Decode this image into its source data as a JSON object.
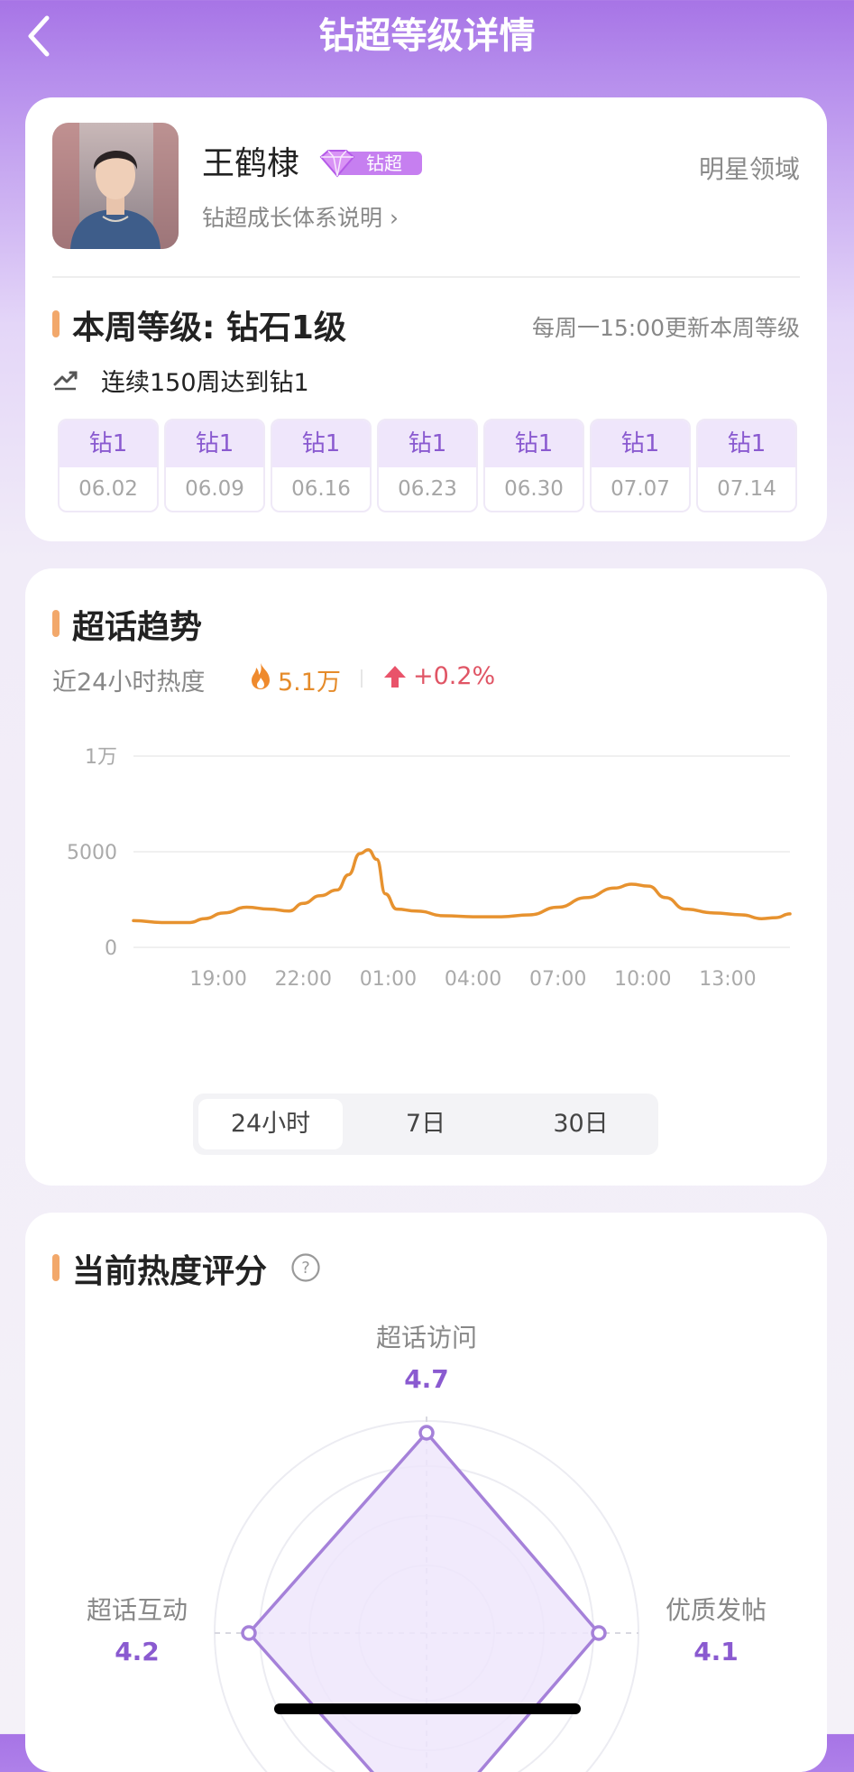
{
  "header": {
    "title": "钻超等级详情"
  },
  "profile": {
    "name": "王鹤棣",
    "badge": "钻超",
    "growth_link": "钻超成长体系说明 ›",
    "domain": "明星领域"
  },
  "level": {
    "title": "本周等级: 钻石1级",
    "update_note": "每周一15:00更新本周等级",
    "streak": "连续150周达到钻1",
    "weeks": [
      {
        "level": "钻1",
        "date": "06.02"
      },
      {
        "level": "钻1",
        "date": "06.09"
      },
      {
        "level": "钻1",
        "date": "06.16"
      },
      {
        "level": "钻1",
        "date": "06.23"
      },
      {
        "level": "钻1",
        "date": "06.30"
      },
      {
        "level": "钻1",
        "date": "07.07"
      },
      {
        "level": "钻1",
        "date": "07.14"
      }
    ]
  },
  "trend": {
    "title": "超话趋势",
    "heat_label": "近24小时热度",
    "heat_value": "5.1万",
    "heat_change": "+0.2%",
    "tabs": [
      "24小时",
      "7日",
      "30日"
    ],
    "active_tab": "24小时"
  },
  "chart_data": {
    "type": "line",
    "title": "",
    "xlabel": "",
    "ylabel": "",
    "y_tick_labels": [
      "0",
      "5000",
      "1万"
    ],
    "y_ticks": [
      0,
      5000,
      10000
    ],
    "ylim": [
      0,
      10000
    ],
    "x_tick_labels": [
      "19:00",
      "22:00",
      "01:00",
      "04:00",
      "07:00",
      "10:00",
      "13:00"
    ],
    "x_tick_positions": [
      19,
      22,
      25,
      28,
      31,
      34,
      37
    ],
    "xlim": [
      16,
      39.2
    ],
    "grid": true,
    "color": "#e7922f",
    "series": [
      {
        "name": "",
        "points": [
          [
            16,
            1400
          ],
          [
            17,
            1300
          ],
          [
            18,
            1300
          ],
          [
            18.5,
            1500
          ],
          [
            19.2,
            1800
          ],
          [
            20,
            2100
          ],
          [
            20.8,
            2000
          ],
          [
            21.5,
            1900
          ],
          [
            22,
            2300
          ],
          [
            22.6,
            2700
          ],
          [
            23.2,
            3000
          ],
          [
            23.6,
            3800
          ],
          [
            24,
            4900
          ],
          [
            24.3,
            5100
          ],
          [
            24.6,
            4600
          ],
          [
            24.9,
            2800
          ],
          [
            25.3,
            2000
          ],
          [
            26,
            1900
          ],
          [
            27,
            1650
          ],
          [
            28,
            1600
          ],
          [
            29,
            1600
          ],
          [
            30,
            1700
          ],
          [
            31,
            2100
          ],
          [
            32,
            2600
          ],
          [
            33,
            3100
          ],
          [
            33.6,
            3300
          ],
          [
            34.2,
            3200
          ],
          [
            34.8,
            2600
          ],
          [
            35.5,
            2000
          ],
          [
            36.5,
            1800
          ],
          [
            37.5,
            1700
          ],
          [
            38.2,
            1500
          ],
          [
            38.7,
            1550
          ],
          [
            39.2,
            1750
          ]
        ]
      }
    ]
  },
  "score": {
    "title": "当前热度评分",
    "axes": [
      {
        "label": "超话访问",
        "value": "4.7"
      },
      {
        "label": "优质发帖",
        "value": "4.1"
      },
      {
        "label": "超话互动",
        "value": "4.2"
      }
    ]
  },
  "colors": {
    "accent": "#8a5ad0",
    "header": "#a774e6",
    "line": "#e7922f",
    "up": "#e05565"
  }
}
